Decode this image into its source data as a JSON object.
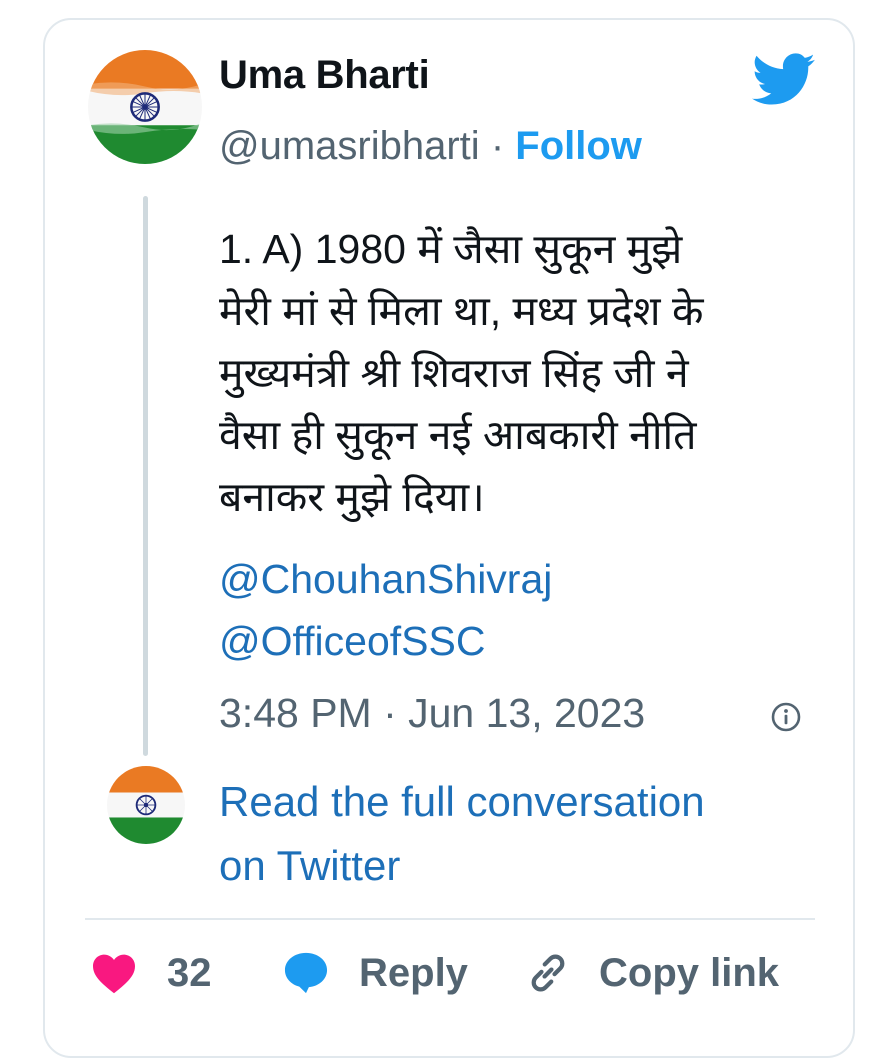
{
  "author": {
    "name": "Uma Bharti",
    "handle": "@umasribharti",
    "separator": "·",
    "follow_label": "Follow",
    "avatar_icon": "india-flag-avatar"
  },
  "tweet": {
    "lines": [
      "1. A) 1980 में जैसा सुकून मुझे",
      "मेरी मां से मिला था, मध्य प्रदेश के",
      "मुख्यमंत्री श्री शिवराज सिंह जी ने",
      "वैसा ही सुकून नई आबकारी नीति",
      "बनाकर मुझे दिया।"
    ],
    "mentions": [
      "@ChouhanShivraj",
      "@OfficeofSSC"
    ],
    "timestamp": "3:48 PM · Jun 13, 2023"
  },
  "read_full": {
    "lines": [
      "Read the full conversation",
      "on Twitter"
    ]
  },
  "actions": {
    "like_count": "32",
    "reply_label": "Reply",
    "copy_label": "Copy link"
  },
  "colors": {
    "link": "#1d6fb8",
    "brand": "#1d9bf0",
    "like": "#f91880",
    "text": "#0f1419",
    "muted": "#536471",
    "saffron": "#e8751f",
    "green": "#1f8a30"
  }
}
